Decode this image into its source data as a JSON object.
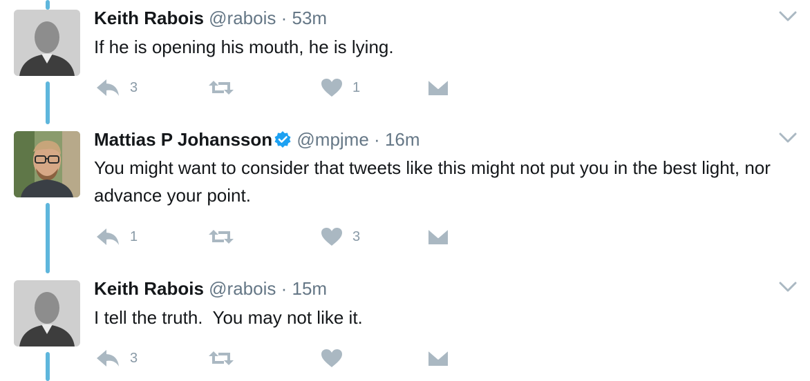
{
  "tweets": [
    {
      "name": "Keith Rabois",
      "handle": "@rabois",
      "separator": "·",
      "time": "53m",
      "text": "If he is opening his mouth, he is lying.",
      "verified": false,
      "avatar": "avatar-keith",
      "reply_count": "3",
      "retweet_count": "",
      "like_count": "1"
    },
    {
      "name": "Mattias P Johansson",
      "handle": "@mpjme",
      "separator": "·",
      "time": "16m",
      "text": "You might want to consider that tweets like this might not put you in the best light, nor advance your point.",
      "verified": true,
      "avatar": "avatar-mattias",
      "reply_count": "1",
      "retweet_count": "",
      "like_count": "3"
    },
    {
      "name": "Keith Rabois",
      "handle": "@rabois",
      "separator": "·",
      "time": "15m",
      "text": "I tell the truth.  You may not like it.",
      "verified": false,
      "avatar": "avatar-keith",
      "reply_count": "3",
      "retweet_count": "",
      "like_count": ""
    }
  ],
  "icons": {
    "reply": "reply-icon",
    "retweet": "retweet-icon",
    "like": "heart-icon",
    "dm": "envelope-icon",
    "caret": "chevron-down-icon",
    "verified": "verified-badge-icon"
  },
  "colors": {
    "thread_line": "#5eb6dc",
    "action_gray": "#aab8c2",
    "handle_gray": "#657786",
    "verified_blue": "#1da1f2"
  }
}
